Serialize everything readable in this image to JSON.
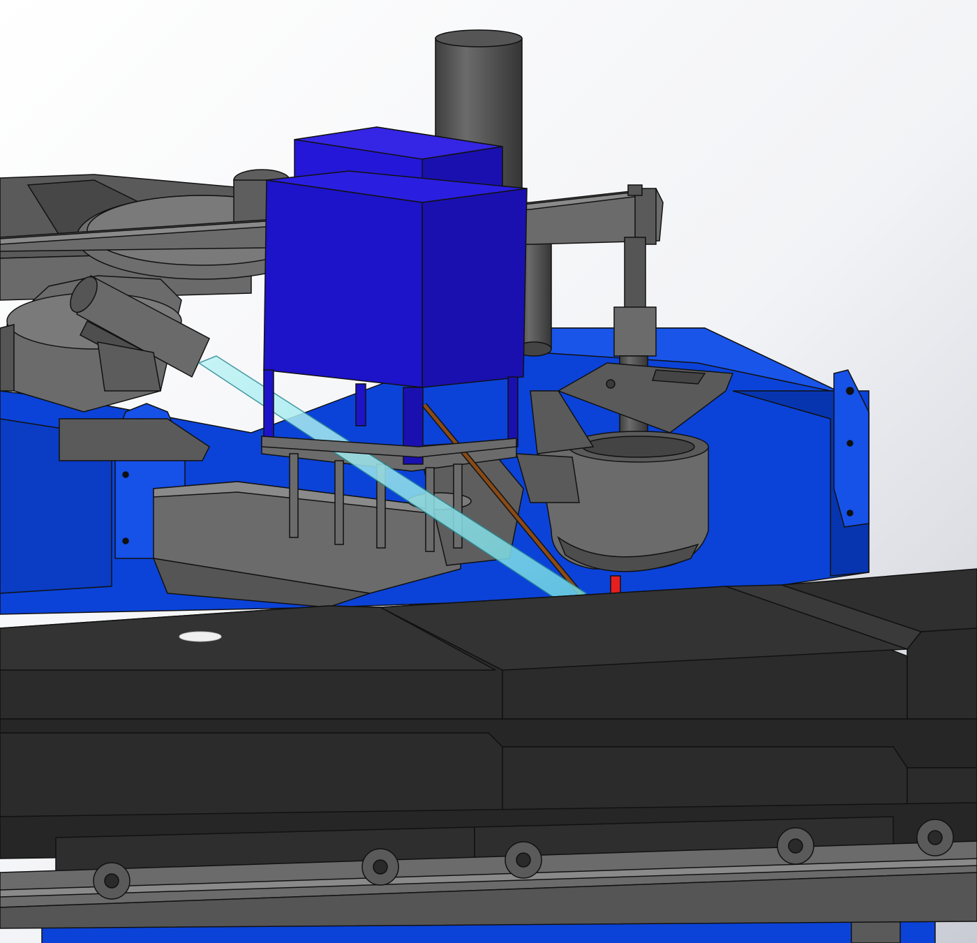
{
  "scene": {
    "kind": "cad-3d-render",
    "labels": []
  },
  "colors": {
    "background_light": "#ffffff",
    "background_grey": "#c9ccd4",
    "steel_dark": "#4a4a4a",
    "steel_mid": "#5e5e5e",
    "steel_light": "#737373",
    "mold_black": "#2b2b2b",
    "mold_top": "#333333",
    "frame_blue": "#0b43d9",
    "frame_blue_dark": "#0735b0",
    "hopper_violet": "#1d13c9",
    "hopper_violet_side": "#1a10b0",
    "hopper_violet_top": "#2417d8",
    "pour_red": "#e61e1e",
    "rod_brown": "#8a4a16",
    "glass_cyan": "#8fe6ee",
    "outline": "#111111"
  }
}
